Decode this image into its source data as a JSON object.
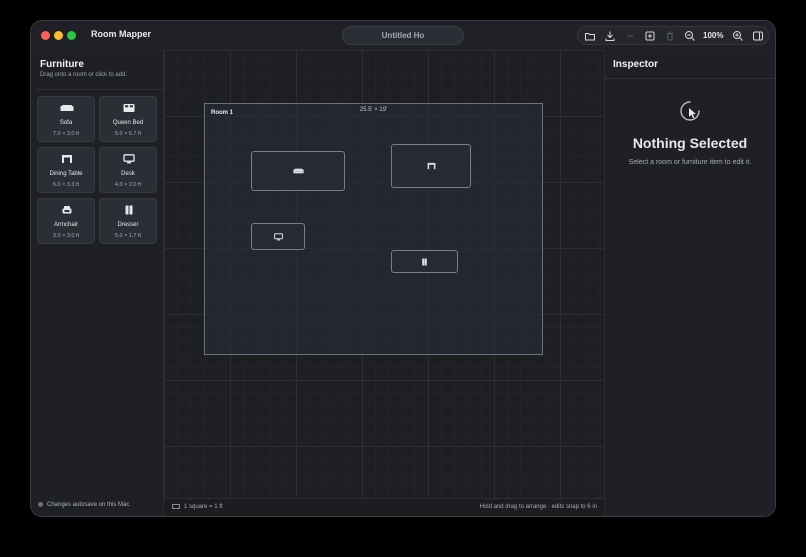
{
  "window": {
    "app_title": "Room Mapper",
    "document_title": "Untitled Ho",
    "zoom_label": "100%"
  },
  "toolbar": {
    "icons": [
      "folder-open-icon",
      "download-icon",
      "minus-icon",
      "add-room-icon",
      "trash-icon",
      "zoom-out-icon",
      "zoom-in-icon",
      "sidebar-toggle-icon"
    ]
  },
  "sidebar": {
    "title": "Furniture",
    "subtitle": "Drag onto a room or click to add.",
    "items": [
      {
        "name": "Sofa",
        "dims": "7.0 × 3.0 ft",
        "icon": "sofa-icon"
      },
      {
        "name": "Queen Bed",
        "dims": "5.0 × 6.7 ft",
        "icon": "bed-icon"
      },
      {
        "name": "Dining Table",
        "dims": "6.0 × 3.3 ft",
        "icon": "table-icon"
      },
      {
        "name": "Desk",
        "dims": "4.0 × 2.0 ft",
        "icon": "desk-icon"
      },
      {
        "name": "Armchair",
        "dims": "3.0 × 3.0 ft",
        "icon": "armchair-icon"
      },
      {
        "name": "Dresser",
        "dims": "5.0 × 1.7 ft",
        "icon": "dresser-icon"
      }
    ],
    "autosave_text": "Changes autosave on this Mac"
  },
  "canvas": {
    "room": {
      "name": "Room 1",
      "dims": "25.5' × 19'"
    },
    "placed_items": [
      "sofa",
      "dining-table",
      "desk",
      "dresser"
    ]
  },
  "statusbar": {
    "scale_text": "1 square = 1 ft",
    "hint_text": "Hold and drag to arrange · edits snap to 6 in"
  },
  "inspector": {
    "title": "Inspector",
    "empty_title": "Nothing Selected",
    "empty_subtitle": "Select a room or furniture item to edit it."
  },
  "colors": {
    "window_bg": "#1b1d22",
    "canvas_bg": "#1e1f22",
    "card_bg": "#2b2e34",
    "room_border": "#6c7079",
    "close": "#ff5f57",
    "minimize": "#febc2e",
    "zoom": "#28c840"
  }
}
